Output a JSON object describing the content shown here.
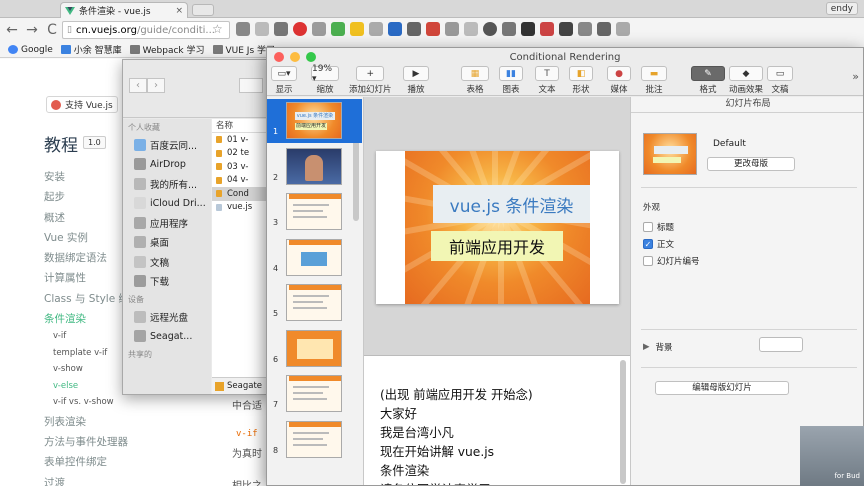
{
  "browser": {
    "tab_title": "条件渲染 - vue.js",
    "tab_close": "×",
    "user": "endy",
    "nav_back": "←",
    "nav_forward": "→",
    "nav_reload": "C",
    "url_host": "cn.vuejs.org",
    "url_path": "/guide/conditi...",
    "bookmarks": [
      "Google",
      "小余 智慧庫",
      "Webpack 学习",
      "VUE Js 学习"
    ]
  },
  "vue_page": {
    "support": "支持 Vue.js",
    "heading": "教程",
    "version": "1.0",
    "nav": [
      {
        "label": "安装",
        "active": false,
        "sub": false
      },
      {
        "label": "起步",
        "active": false,
        "sub": false
      },
      {
        "label": "概述",
        "active": false,
        "sub": false
      },
      {
        "label": "Vue 实例",
        "active": false,
        "sub": false
      },
      {
        "label": "数据绑定语法",
        "active": false,
        "sub": false
      },
      {
        "label": "计算属性",
        "active": false,
        "sub": false
      },
      {
        "label": "Class 与 Style 绑定",
        "active": false,
        "sub": false
      },
      {
        "label": "条件渲染",
        "active": true,
        "sub": false
      },
      {
        "label": "v-if",
        "active": false,
        "sub": true
      },
      {
        "label": "template v-if",
        "active": false,
        "sub": true
      },
      {
        "label": "v-show",
        "active": false,
        "sub": true
      },
      {
        "label": "v-else",
        "active": true,
        "sub": true
      },
      {
        "label": "v-if vs. v-show",
        "active": false,
        "sub": true
      },
      {
        "label": "列表渲染",
        "active": false,
        "sub": false
      },
      {
        "label": "方法与事件处理器",
        "active": false,
        "sub": false
      },
      {
        "label": "表单控件绑定",
        "active": false,
        "sub": false
      },
      {
        "label": "过渡",
        "active": false,
        "sub": false
      }
    ],
    "snippet1": "中合适",
    "code": "v-if",
    "snippet2": "为真时",
    "snippet3": "相比之"
  },
  "finder": {
    "back": "‹",
    "forward": "›",
    "section_personal": "个人收藏",
    "favorites": [
      {
        "label": "百度云同...",
        "icon": "cloud-icon",
        "color": "#7ab0e6"
      },
      {
        "label": "AirDrop",
        "icon": "airdrop-icon",
        "color": "#9a9a9a"
      },
      {
        "label": "我的所有...",
        "icon": "all-files-icon",
        "color": "#b8b8b8"
      },
      {
        "label": "iCloud Dri...",
        "icon": "icloud-icon",
        "color": "#d8d8d8"
      },
      {
        "label": "应用程序",
        "icon": "applications-icon",
        "color": "#a8a8a8"
      },
      {
        "label": "桌面",
        "icon": "desktop-icon",
        "color": "#b0b0b0"
      },
      {
        "label": "文稿",
        "icon": "documents-icon",
        "color": "#c4c4c4"
      },
      {
        "label": "下载",
        "icon": "downloads-icon",
        "color": "#9c9c9c"
      }
    ],
    "section_devices": "设备",
    "devices": [
      {
        "label": "远程光盘",
        "icon": "disc-icon",
        "color": "#bcbcbc"
      },
      {
        "label": "Seagat...",
        "icon": "drive-icon",
        "color": "#a4a4a4"
      }
    ],
    "section_shared": "共享的",
    "column_name": "名称",
    "files": [
      {
        "label": "01 v-",
        "color": "#e8a32a",
        "sel": false
      },
      {
        "label": "02 te",
        "color": "#e8a32a",
        "sel": false
      },
      {
        "label": "03 v-",
        "color": "#e8a32a",
        "sel": false
      },
      {
        "label": "04 v-",
        "color": "#e8a32a",
        "sel": false
      },
      {
        "label": "Cond",
        "color": "#e8a32a",
        "sel": true
      },
      {
        "label": "vue.js",
        "color": "#b8c8d8",
        "sel": false
      }
    ],
    "path_item": "Seagate"
  },
  "keynote": {
    "title": "Conditional Rendering",
    "toolbar": [
      {
        "label": "显示",
        "icon": "view-icon",
        "glyph": "▭▾"
      },
      {
        "label": "缩放",
        "icon": "zoom-icon",
        "glyph": "19% ▾"
      },
      {
        "label": "添加幻灯片",
        "icon": "add-slide-icon",
        "glyph": "+"
      },
      {
        "label": "播放",
        "icon": "play-icon",
        "glyph": "▶"
      },
      {
        "label": "表格",
        "icon": "table-icon",
        "glyph": "▦"
      },
      {
        "label": "图表",
        "icon": "chart-icon",
        "glyph": "▮▮"
      },
      {
        "label": "文本",
        "icon": "text-icon",
        "glyph": "T"
      },
      {
        "label": "形状",
        "icon": "shape-icon",
        "glyph": "◧"
      },
      {
        "label": "媒体",
        "icon": "media-icon",
        "glyph": "●"
      },
      {
        "label": "批注",
        "icon": "comment-icon",
        "glyph": "▬"
      },
      {
        "label": "格式",
        "icon": "format-icon",
        "glyph": "✎"
      },
      {
        "label": "动画效果",
        "icon": "animate-icon",
        "glyph": "◆"
      },
      {
        "label": "文稿",
        "icon": "document-icon",
        "glyph": "▭"
      }
    ],
    "more": "»",
    "slide_numbers": [
      "1",
      "2",
      "3",
      "4",
      "5",
      "6",
      "7",
      "8"
    ],
    "thumb1_title": "vue.js 条件渲染",
    "thumb1_sub": "前端应用开发",
    "slide_title": "vue.js 条件渲染",
    "slide_subtitle": "前端应用开发",
    "notes": [
      "(出现 前端应用开发 开始念)",
      "大家好",
      "我是台湾小凡",
      "现在开始讲解 vue.js",
      "条件渲染",
      "请各位同学认真学习"
    ],
    "inspector": {
      "header": "幻灯片布局",
      "master_name": "Default",
      "change_master": "更改母版",
      "appearance": "外观",
      "checkboxes": [
        {
          "label": "标题",
          "checked": false
        },
        {
          "label": "正文",
          "checked": true
        },
        {
          "label": "幻灯片编号",
          "checked": false
        }
      ],
      "background": "背景",
      "edit_master": "编辑母版幻灯片"
    }
  },
  "webcam_watermark": "for Bud"
}
